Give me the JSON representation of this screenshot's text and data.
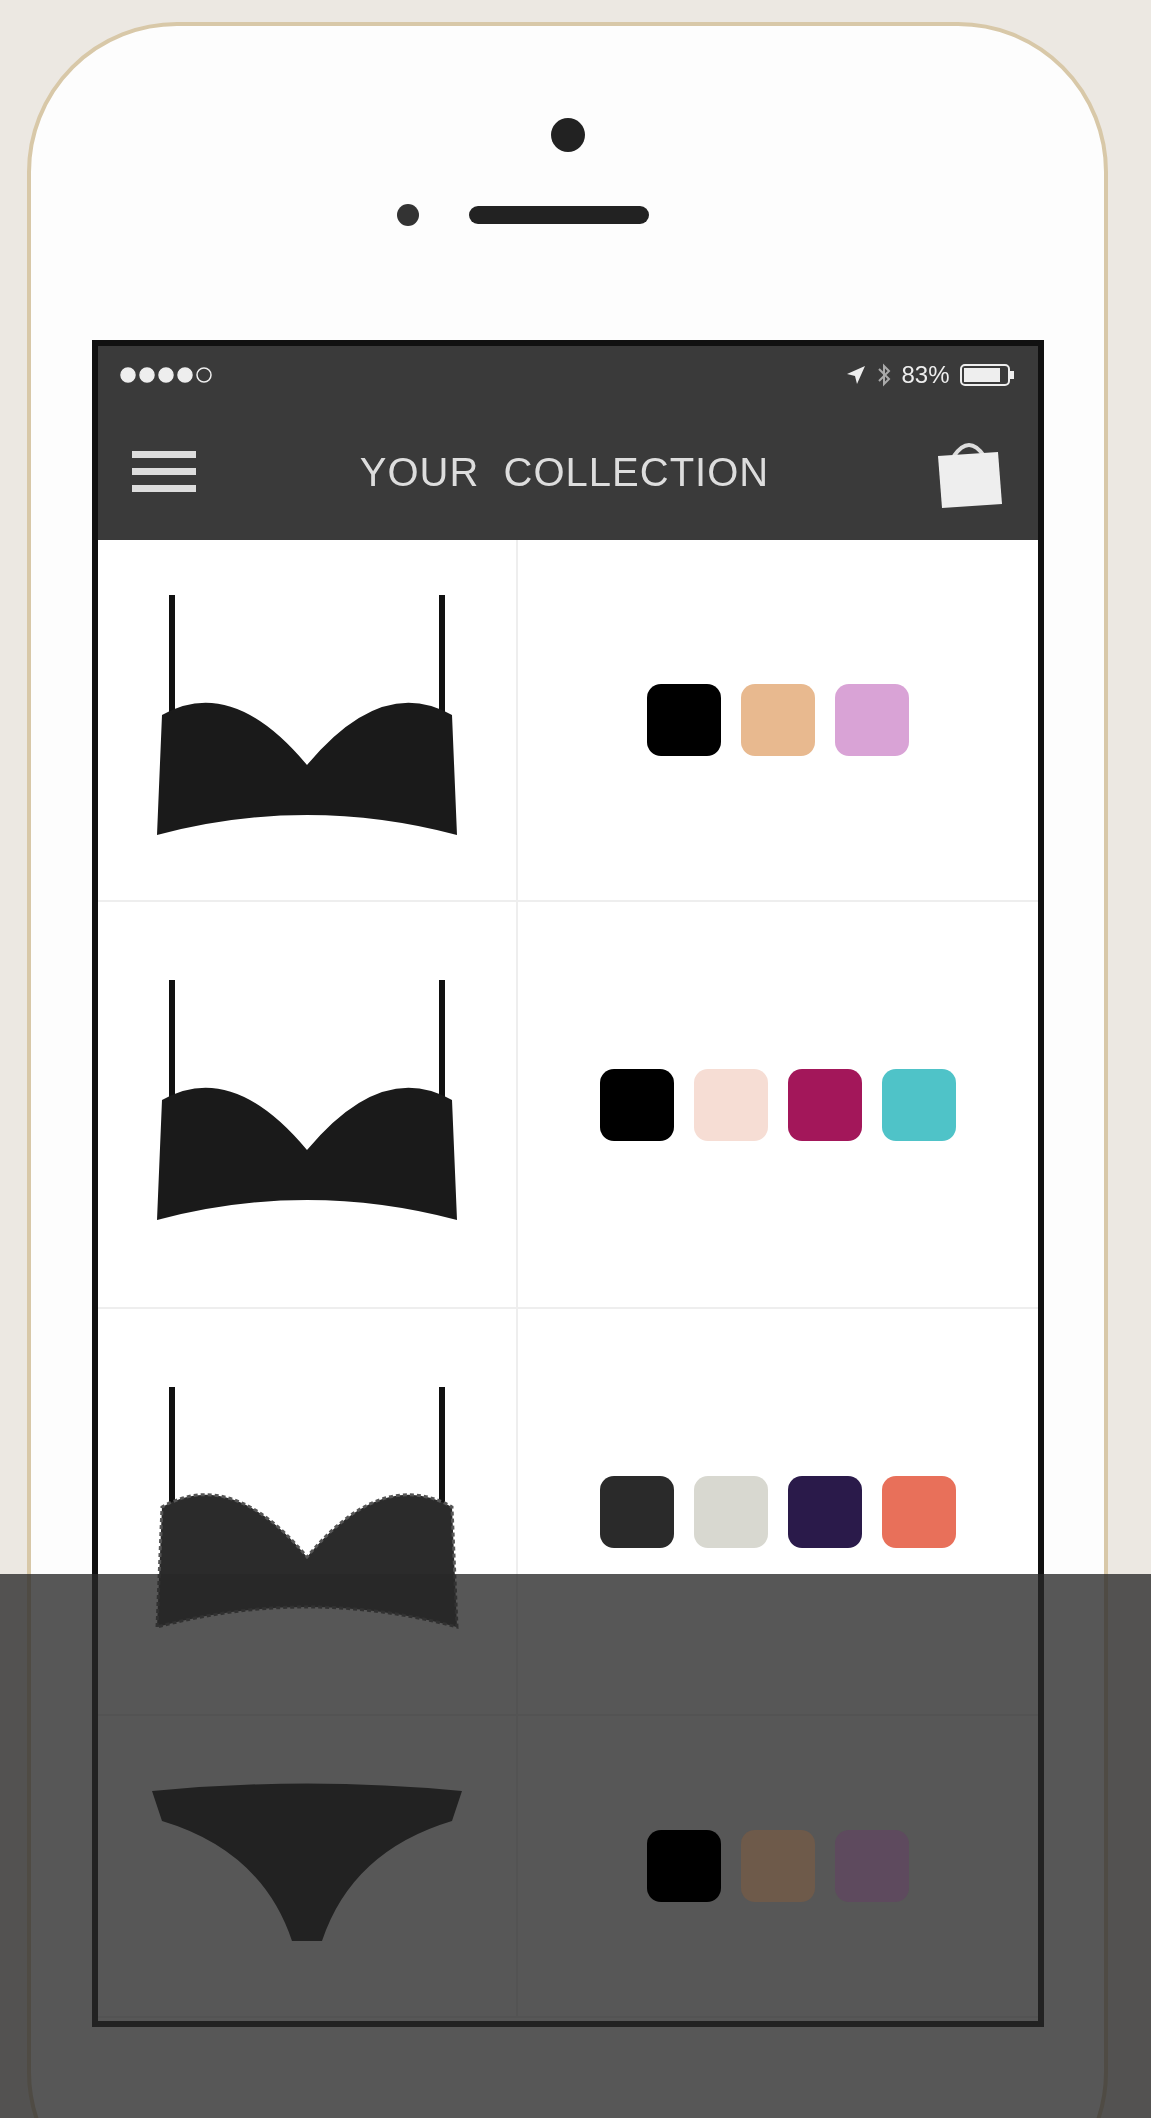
{
  "status_bar": {
    "battery_text": "83%"
  },
  "header": {
    "title": "YOUR  COLLECTION"
  },
  "products": [
    {
      "kind": "bra",
      "swatches": [
        {
          "color": "#000000"
        },
        {
          "color": "#e8b98f"
        },
        {
          "color": "#d9a3d6"
        }
      ]
    },
    {
      "kind": "bra",
      "swatches": [
        {
          "color": "#000000"
        },
        {
          "color": "#f6ddd4"
        },
        {
          "color": "#a3175a"
        },
        {
          "color": "#4fc3c8"
        }
      ]
    },
    {
      "kind": "lace-bra",
      "swatches": [
        {
          "color": "#2a2a2a"
        },
        {
          "color": "#d8d8d0"
        },
        {
          "color": "#2a1a4a"
        },
        {
          "color": "#e8705a"
        }
      ]
    },
    {
      "kind": "panty",
      "swatches": [
        {
          "color": "#000000"
        },
        {
          "color": "#6e5a4a"
        },
        {
          "color": "#5e4a5e"
        }
      ]
    }
  ]
}
